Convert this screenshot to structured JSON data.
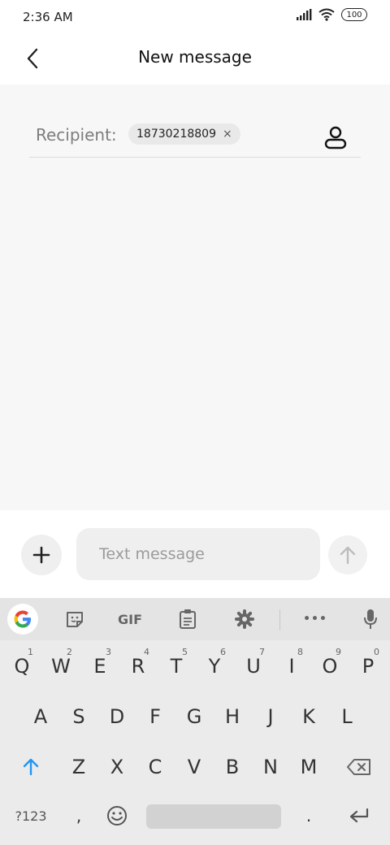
{
  "status": {
    "time": "2:36 AM",
    "battery": "100"
  },
  "header": {
    "title": "New message"
  },
  "recipient": {
    "label": "Recipient:",
    "chip_number": "18730218809",
    "chip_remove": "×"
  },
  "compose": {
    "placeholder": "Text message"
  },
  "keyboard": {
    "toolbar": {
      "gif": "GIF",
      "more": "•••"
    },
    "row1": [
      {
        "key": "Q",
        "num": "1"
      },
      {
        "key": "W",
        "num": "2"
      },
      {
        "key": "E",
        "num": "3"
      },
      {
        "key": "R",
        "num": "4"
      },
      {
        "key": "T",
        "num": "5"
      },
      {
        "key": "Y",
        "num": "6"
      },
      {
        "key": "U",
        "num": "7"
      },
      {
        "key": "I",
        "num": "8"
      },
      {
        "key": "O",
        "num": "9"
      },
      {
        "key": "P",
        "num": "0"
      }
    ],
    "row2": [
      "A",
      "S",
      "D",
      "F",
      "G",
      "H",
      "J",
      "K",
      "L"
    ],
    "row3": [
      "Z",
      "X",
      "C",
      "V",
      "B",
      "N",
      "M"
    ],
    "bottom": {
      "symbols": "?123",
      "comma": ",",
      "period": "."
    }
  }
}
